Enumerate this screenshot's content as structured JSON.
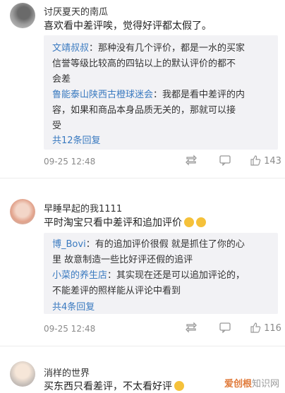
{
  "comments": [
    {
      "username": "讨厌夏天的南瓜",
      "text": "喜欢看中差评唉，觉得好评都太假了。",
      "replies": [
        {
          "name": "文靖叔叔",
          "lines": [
            "：那种没有几个评价，都是一水的买家",
            "信誉等级比较高的四钻以上的默认评价的都不",
            "会差"
          ]
        },
        {
          "name": "鲁能泰山陕西古橙球迷会",
          "lines": [
            "：我都是看中差评的内",
            "容，如果和商品本身品质无关的，那就可以接",
            "受"
          ]
        }
      ],
      "more": "共12条回复",
      "date": "09-25 12:48",
      "likes": "143"
    },
    {
      "username": "早睡早起的我1111",
      "text": "平时淘宝只看中差评和追加评价",
      "replies": [
        {
          "name": "博_Bovi",
          "lines": [
            "：有的追加评价很假 就是抓住了你的心",
            "里 故意制造一些比好评还假的追评"
          ]
        },
        {
          "name": "小菜的养生店",
          "lines": [
            "：其实现在还是可以追加评论的，",
            "不能差评的照样能从评论中看到"
          ]
        }
      ],
      "more": "共4条回复",
      "date": "09-25 12:48",
      "likes": "116"
    },
    {
      "username": "消样的世界",
      "text": "买东西只看差评，不太看好评"
    }
  ],
  "watermark": {
    "brand": "爱创根",
    "suffix": "知识网"
  },
  "colors": {
    "link": "#3a7ac0",
    "reply_bg": "#f2f2f5",
    "meta": "#8a8a8a"
  },
  "icons": [
    "repost-icon",
    "comment-icon",
    "like-icon",
    "emoji-icon"
  ]
}
